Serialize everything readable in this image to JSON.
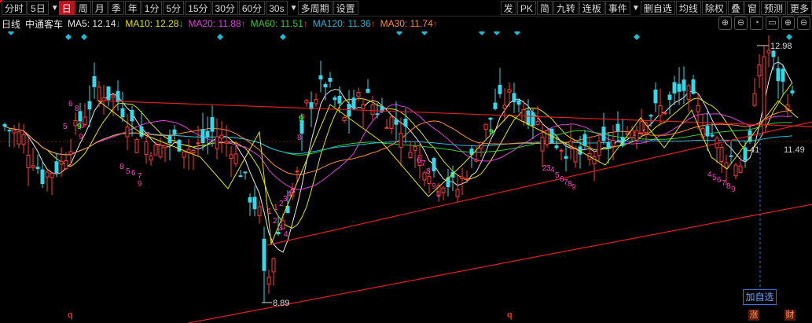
{
  "toolbar": {
    "left": [
      "分时",
      "5日",
      "日",
      "周",
      "月",
      "季",
      "年",
      "1分",
      "5分",
      "15分",
      "30分",
      "60分",
      "30s",
      "多周期",
      "设置"
    ],
    "active": "日",
    "right": [
      "发",
      "PK",
      "简",
      "九转",
      "连板",
      "事件",
      "删自选",
      "均线",
      "除权",
      "叠",
      "窗",
      "预测",
      "更多"
    ]
  },
  "info": {
    "period": "日线",
    "name": "中通客车",
    "ma": [
      {
        "label": "MA5: 12.14",
        "arrow": "↓",
        "color": "#e8e8e8",
        "arrow_color": "#33cc33"
      },
      {
        "label": "MA10: 12.28",
        "arrow": "↓",
        "color": "#e6e600",
        "arrow_color": "#33cc33"
      },
      {
        "label": "MA20: 11.88",
        "arrow": "↑",
        "color": "#e040e0",
        "arrow_color": "#ff3333"
      },
      {
        "label": "MA60: 11.51",
        "arrow": "↑",
        "color": "#33cc33",
        "arrow_color": "#ff3333"
      },
      {
        "label": "MA120: 11.36",
        "arrow": "↑",
        "color": "#22b8d8",
        "arrow_color": "#ff3333"
      },
      {
        "label": "MA30: 11.74",
        "arrow": "↑",
        "color": "#ff8844",
        "arrow_color": "#ff3333"
      }
    ]
  },
  "window_buttons": [
    "⊕",
    "⊖",
    "◔",
    "▭",
    "⊕",
    "⊖"
  ],
  "chart_data": {
    "type": "candlestick",
    "high_label": "12.98",
    "low_label": "8.89",
    "right_labels": [
      "41",
      "11.49"
    ],
    "nine_turn_marks": [
      "6",
      "8",
      "9",
      "5",
      "9",
      "1",
      "2",
      "3",
      "4",
      "9",
      "8",
      "7",
      "5",
      "6",
      "7",
      "8",
      "9",
      "1",
      "2",
      "3",
      "4",
      "5",
      "6",
      "7",
      "8",
      "9",
      "1",
      "2",
      "3",
      "4",
      "5",
      "6",
      "7",
      "8",
      "9",
      "4",
      "5",
      "6",
      "7",
      "8",
      "9"
    ],
    "bottom_marks": [
      "q",
      "q"
    ]
  },
  "add_favorite": "加自选",
  "badges": [
    "涨",
    "财"
  ]
}
